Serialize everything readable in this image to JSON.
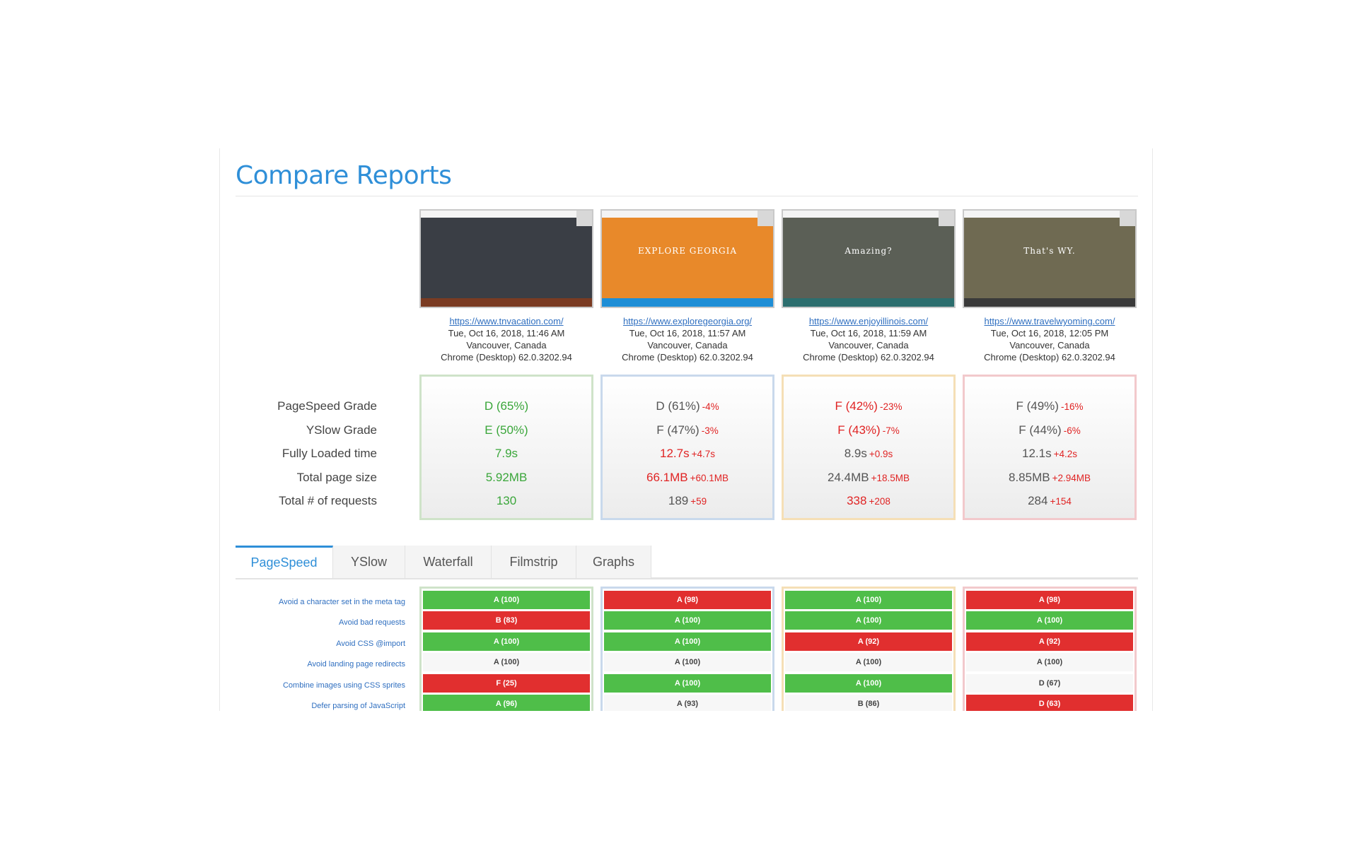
{
  "title": "Compare Reports",
  "reports": [
    {
      "url": "https://www.tnvacation.com/",
      "date": "Tue, Oct 16, 2018, 11:46 AM",
      "location": "Vancouver, Canada",
      "browser": "Chrome (Desktop) 62.0.3202.94",
      "border_color": "#cfe3c9",
      "thumb": {
        "hero_color": "#3a3e45",
        "bar_color": "#7a3b22",
        "caption": ""
      },
      "metrics": {
        "pagespeed": {
          "value": "D (65%)",
          "delta": "",
          "status": "good"
        },
        "yslow": {
          "value": "E (50%)",
          "delta": "",
          "status": "good"
        },
        "loaded": {
          "value": "7.9s",
          "delta": "",
          "status": "good"
        },
        "size": {
          "value": "5.92MB",
          "delta": "",
          "status": "good"
        },
        "requests": {
          "value": "130",
          "delta": "",
          "status": "good"
        }
      },
      "scores": [
        {
          "value": "A (100)",
          "status": "green"
        },
        {
          "value": "B (83)",
          "status": "red"
        },
        {
          "value": "A (100)",
          "status": "green"
        },
        {
          "value": "A (100)",
          "status": "plain"
        },
        {
          "value": "F (25)",
          "status": "red"
        },
        {
          "value": "A (96)",
          "status": "green"
        }
      ]
    },
    {
      "url": "https://www.exploregeorgia.org/",
      "date": "Tue, Oct 16, 2018, 11:57 AM",
      "location": "Vancouver, Canada",
      "browser": "Chrome (Desktop) 62.0.3202.94",
      "border_color": "#c9d9ec",
      "thumb": {
        "hero_color": "#e8892a",
        "bar_color": "#1e8ed6",
        "caption": "EXPLORE GEORGIA"
      },
      "metrics": {
        "pagespeed": {
          "value": "D (61%)",
          "delta": "-4%",
          "status": "neutral"
        },
        "yslow": {
          "value": "F (47%)",
          "delta": "-3%",
          "status": "neutral"
        },
        "loaded": {
          "value": "12.7s",
          "delta": "+4.7s",
          "status": "bad"
        },
        "size": {
          "value": "66.1MB",
          "delta": "+60.1MB",
          "status": "bad"
        },
        "requests": {
          "value": "189",
          "delta": "+59",
          "status": "neutral"
        }
      },
      "scores": [
        {
          "value": "A (98)",
          "status": "red"
        },
        {
          "value": "A (100)",
          "status": "green"
        },
        {
          "value": "A (100)",
          "status": "green"
        },
        {
          "value": "A (100)",
          "status": "plain"
        },
        {
          "value": "A (100)",
          "status": "green"
        },
        {
          "value": "A (93)",
          "status": "plain"
        }
      ]
    },
    {
      "url": "https://www.enjoyillinois.com/",
      "date": "Tue, Oct 16, 2018, 11:59 AM",
      "location": "Vancouver, Canada",
      "browser": "Chrome (Desktop) 62.0.3202.94",
      "border_color": "#f5dfb6",
      "thumb": {
        "hero_color": "#5b5f56",
        "bar_color": "#2c6e6e",
        "caption": "Amazing?"
      },
      "metrics": {
        "pagespeed": {
          "value": "F (42%)",
          "delta": "-23%",
          "status": "bad"
        },
        "yslow": {
          "value": "F (43%)",
          "delta": "-7%",
          "status": "bad"
        },
        "loaded": {
          "value": "8.9s",
          "delta": "+0.9s",
          "status": "neutral"
        },
        "size": {
          "value": "24.4MB",
          "delta": "+18.5MB",
          "status": "neutral"
        },
        "requests": {
          "value": "338",
          "delta": "+208",
          "status": "bad"
        }
      },
      "scores": [
        {
          "value": "A (100)",
          "status": "green"
        },
        {
          "value": "A (100)",
          "status": "green"
        },
        {
          "value": "A (92)",
          "status": "red"
        },
        {
          "value": "A (100)",
          "status": "plain"
        },
        {
          "value": "A (100)",
          "status": "green"
        },
        {
          "value": "B (86)",
          "status": "plain"
        }
      ]
    },
    {
      "url": "https://www.travelwyoming.com/",
      "date": "Tue, Oct 16, 2018, 12:05 PM",
      "location": "Vancouver, Canada",
      "browser": "Chrome (Desktop) 62.0.3202.94",
      "border_color": "#f2c9cc",
      "thumb": {
        "hero_color": "#6f6a52",
        "bar_color": "#3a3a3a",
        "caption": "That's WY."
      },
      "metrics": {
        "pagespeed": {
          "value": "F (49%)",
          "delta": "-16%",
          "status": "neutral"
        },
        "yslow": {
          "value": "F (44%)",
          "delta": "-6%",
          "status": "neutral"
        },
        "loaded": {
          "value": "12.1s",
          "delta": "+4.2s",
          "status": "neutral"
        },
        "size": {
          "value": "8.85MB",
          "delta": "+2.94MB",
          "status": "neutral"
        },
        "requests": {
          "value": "284",
          "delta": "+154",
          "status": "neutral"
        }
      },
      "scores": [
        {
          "value": "A (98)",
          "status": "red"
        },
        {
          "value": "A (100)",
          "status": "green"
        },
        {
          "value": "A (92)",
          "status": "red"
        },
        {
          "value": "A (100)",
          "status": "plain"
        },
        {
          "value": "D (67)",
          "status": "plain"
        },
        {
          "value": "D (63)",
          "status": "red"
        }
      ]
    }
  ],
  "metric_labels": {
    "pagespeed": "PageSpeed Grade",
    "yslow": "YSlow Grade",
    "loaded": "Fully Loaded time",
    "size": "Total page size",
    "requests": "Total # of requests"
  },
  "tabs": [
    {
      "label": "PageSpeed",
      "active": true
    },
    {
      "label": "YSlow",
      "active": false
    },
    {
      "label": "Waterfall",
      "active": false
    },
    {
      "label": "Filmstrip",
      "active": false
    },
    {
      "label": "Graphs",
      "active": false
    }
  ],
  "rules": [
    "Avoid a character set in the meta tag",
    "Avoid bad requests",
    "Avoid CSS @import",
    "Avoid landing page redirects",
    "Combine images using CSS sprites",
    "Defer parsing of JavaScript"
  ],
  "colors": {
    "accent": "#2f8fd8",
    "good": "#3aa63a",
    "bad": "#e02424",
    "score_green": "#4fbe49",
    "score_red": "#e12f2f"
  }
}
